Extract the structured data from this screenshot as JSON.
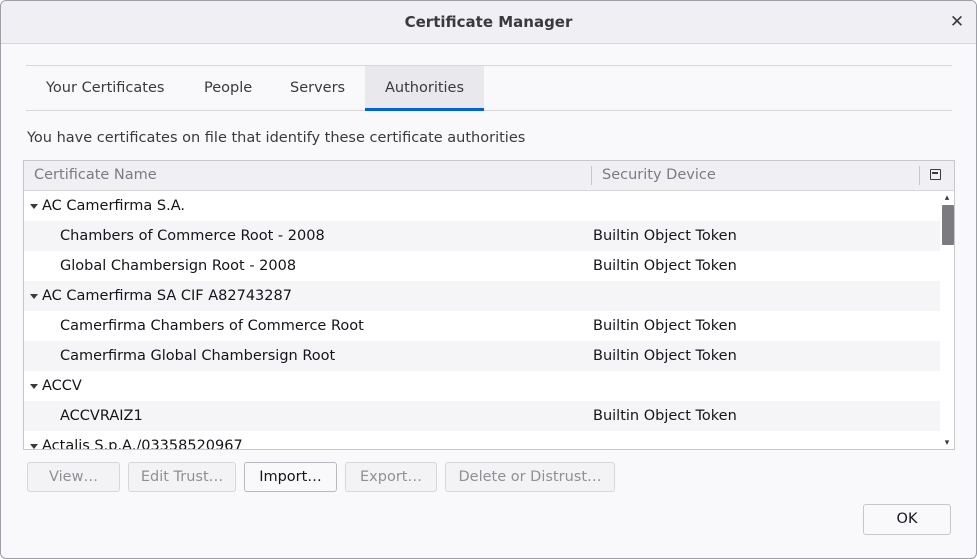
{
  "dialog": {
    "title": "Certificate Manager",
    "close_icon": "close-icon"
  },
  "tabs": [
    {
      "label": "Your Certificates",
      "selected": false
    },
    {
      "label": "People",
      "selected": false
    },
    {
      "label": "Servers",
      "selected": false
    },
    {
      "label": "Authorities",
      "selected": true
    }
  ],
  "description": "You have certificates on file that identify these certificate authorities",
  "tree": {
    "columns": {
      "name": "Certificate Name",
      "device": "Security Device"
    },
    "rows": [
      {
        "type": "group",
        "name": "AC Camerfirma S.A.",
        "device": ""
      },
      {
        "type": "item",
        "name": "Chambers of Commerce Root - 2008",
        "device": "Builtin Object Token"
      },
      {
        "type": "item",
        "name": "Global Chambersign Root - 2008",
        "device": "Builtin Object Token"
      },
      {
        "type": "group",
        "name": "AC Camerfirma SA CIF A82743287",
        "device": ""
      },
      {
        "type": "item",
        "name": "Camerfirma Chambers of Commerce Root",
        "device": "Builtin Object Token"
      },
      {
        "type": "item",
        "name": "Camerfirma Global Chambersign Root",
        "device": "Builtin Object Token"
      },
      {
        "type": "group",
        "name": "ACCV",
        "device": ""
      },
      {
        "type": "item",
        "name": "ACCVRAIZ1",
        "device": "Builtin Object Token"
      },
      {
        "type": "group",
        "name": "Actalis S.p.A./03358520967",
        "device": ""
      }
    ]
  },
  "buttons": {
    "view": "View…",
    "edit_trust": "Edit Trust…",
    "import": "Import…",
    "export": "Export…",
    "delete": "Delete or Distrust…",
    "ok": "OK"
  }
}
